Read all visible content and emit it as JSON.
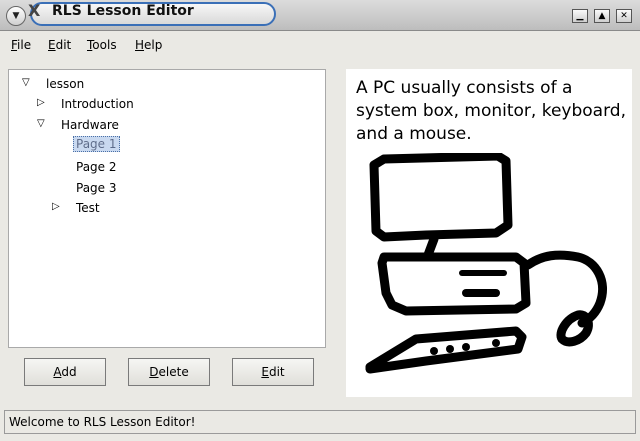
{
  "window": {
    "title": "RLS Lesson Editor",
    "app_icon": "x-icon",
    "controls": [
      "minimize-icon",
      "maximize-icon",
      "close-icon"
    ]
  },
  "menubar": {
    "file": {
      "accel": "F",
      "rest": "ile"
    },
    "edit": {
      "accel": "E",
      "rest": "dit"
    },
    "tools": {
      "accel": "T",
      "rest": "ools"
    },
    "help": {
      "accel": "H",
      "rest": "elp"
    }
  },
  "tree": {
    "root": "lesson",
    "introduction": "Introduction",
    "hardware": "Hardware",
    "page1": "Page 1",
    "page2": "Page 2",
    "page3": "Page 3",
    "test": "Test"
  },
  "content": {
    "text": "A PC usually consists of a system box, monitor, keyboard, and a mouse."
  },
  "buttons": {
    "add": {
      "accel": "A",
      "rest": "dd"
    },
    "delete": {
      "accel": "D",
      "rest": "elete"
    },
    "edit": {
      "accel": "E",
      "rest": "dit"
    }
  },
  "status": {
    "text": "Welcome to RLS Lesson Editor!"
  }
}
